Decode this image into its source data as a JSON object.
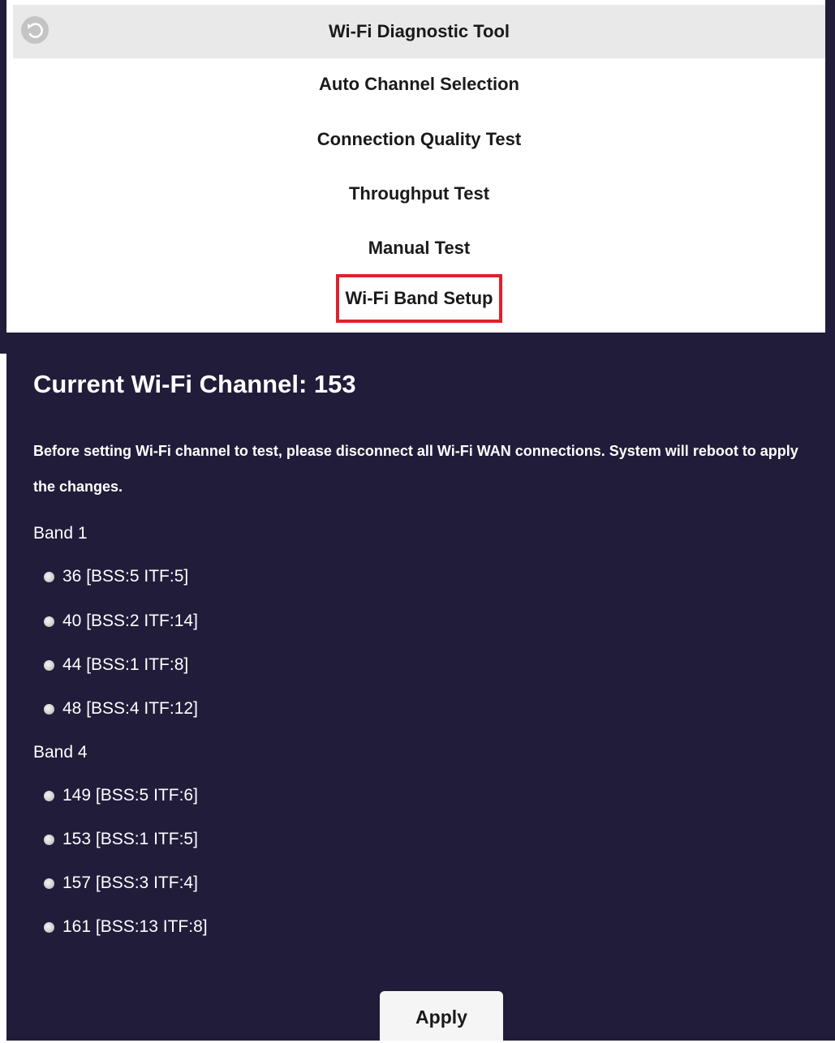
{
  "menu": {
    "title": "Wi-Fi Diagnostic Tool",
    "items": [
      {
        "label": "Auto Channel Selection"
      },
      {
        "label": "Connection Quality Test"
      },
      {
        "label": "Throughput Test"
      },
      {
        "label": "Manual Test"
      },
      {
        "label": "Wi-Fi Band Setup",
        "highlighted": true
      }
    ]
  },
  "main": {
    "title": "Current Wi-Fi Channel: 153",
    "notice": "Before setting Wi-Fi channel to test, please disconnect all Wi-Fi WAN connections. System will reboot to apply the changes.",
    "bands": [
      {
        "label": "Band 1",
        "channels": [
          {
            "label": "36 [BSS:5 ITF:5]"
          },
          {
            "label": "40 [BSS:2 ITF:14]"
          },
          {
            "label": "44 [BSS:1 ITF:8]"
          },
          {
            "label": "48 [BSS:4 ITF:12]"
          }
        ]
      },
      {
        "label": "Band 4",
        "channels": [
          {
            "label": "149 [BSS:5 ITF:6]"
          },
          {
            "label": "153 [BSS:1 ITF:5]"
          },
          {
            "label": "157 [BSS:3 ITF:4]"
          },
          {
            "label": "161 [BSS:13 ITF:8]"
          }
        ]
      }
    ],
    "apply_label": "Apply"
  },
  "icons": {
    "back": "back-arrow-icon"
  },
  "colors": {
    "panel_background": "#201c3a",
    "menu_header_background": "#e9e9e9",
    "highlight_border": "#e0202c"
  }
}
